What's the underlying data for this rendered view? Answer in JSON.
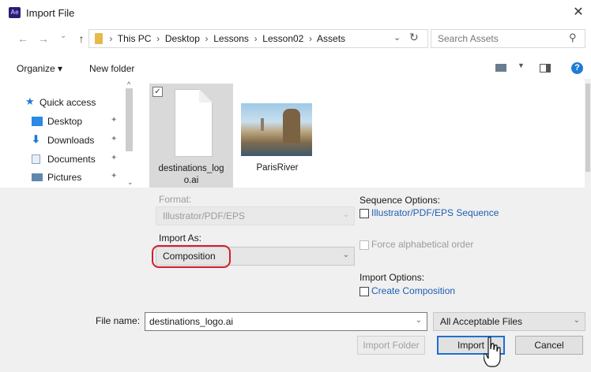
{
  "window": {
    "title": "Import File",
    "app_icon": "Ae",
    "close_glyph": "✕"
  },
  "navigation": {
    "back": "←",
    "forward": "→",
    "up": "↑",
    "breadcrumb": [
      "This PC",
      "Desktop",
      "Lessons",
      "Lesson02",
      "Assets"
    ],
    "breadcrumb_sep": ">",
    "search_placeholder": "Search Assets"
  },
  "toolbar": {
    "organize": "Organize ▾",
    "new_folder": "New folder",
    "help": "?"
  },
  "nav_pane": {
    "items": [
      {
        "label": "Quick access",
        "icon": "star-icon",
        "pinned": false
      },
      {
        "label": "Desktop",
        "icon": "desktop-icon",
        "pinned": true
      },
      {
        "label": "Downloads",
        "icon": "download-icon",
        "pinned": true
      },
      {
        "label": "Documents",
        "icon": "documents-icon",
        "pinned": true
      },
      {
        "label": "Pictures",
        "icon": "pictures-icon",
        "pinned": true
      }
    ]
  },
  "files": [
    {
      "name": "destinations_logo.ai",
      "name_wrapped": [
        "destinations_log",
        "o.ai"
      ],
      "selected": true,
      "checked": true
    },
    {
      "name": "ParisRiver",
      "selected": false,
      "checked": false
    }
  ],
  "options": {
    "format_label": "Format:",
    "format_value": "Illustrator/PDF/EPS",
    "import_as_label": "Import As:",
    "import_as_value": "Composition",
    "sequence_options_label": "Sequence Options:",
    "sequence_checkbox": "Illustrator/PDF/EPS Sequence",
    "force_alpha": "Force alphabetical order",
    "import_options_label": "Import Options:",
    "create_composition": "Create Composition"
  },
  "footer": {
    "filename_label": "File name:",
    "filename_value": "destinations_logo.ai",
    "filetype_value": "All Acceptable Files",
    "import_folder": "Import Folder",
    "import": "Import",
    "cancel": "Cancel"
  },
  "colors": {
    "accent_link": "#1d5fb3",
    "highlight_ring": "#d11f2a",
    "default_button_border": "#1f6fd1"
  }
}
